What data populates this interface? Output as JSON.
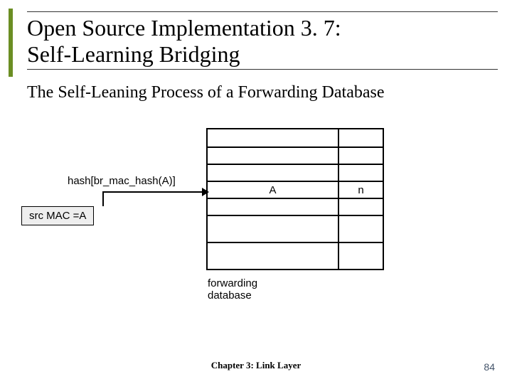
{
  "title": {
    "line1": "Open Source Implementation 3. 7:",
    "line2": "Self-Learning Bridging"
  },
  "subtitle": "The Self-Leaning Process of a Forwarding Database",
  "diagram": {
    "hash_label": "hash[br_mac_hash(A)]",
    "src_box": "src MAC =A",
    "entry_mac": "A",
    "entry_port": "n",
    "fdb_label_line1": "forwarding",
    "fdb_label_line2": "database"
  },
  "footer": {
    "chapter": "Chapter 3: Link Layer",
    "page": "84"
  }
}
